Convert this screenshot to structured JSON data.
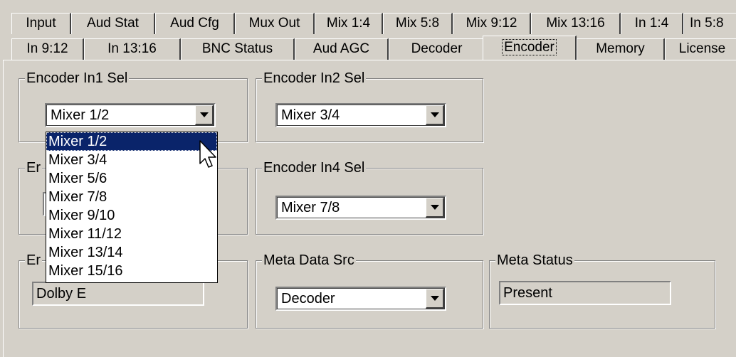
{
  "tabs": {
    "row1": [
      {
        "label": "Input"
      },
      {
        "label": "Aud Stat"
      },
      {
        "label": "Aud Cfg"
      },
      {
        "label": "Mux Out"
      },
      {
        "label": "Mix 1:4"
      },
      {
        "label": "Mix 5:8"
      },
      {
        "label": "Mix 9:12"
      },
      {
        "label": "Mix 13:16"
      },
      {
        "label": "In 1:4"
      },
      {
        "label": "In 5:8"
      }
    ],
    "row2": [
      {
        "label": "In 9:12"
      },
      {
        "label": "In 13:16"
      },
      {
        "label": "BNC Status"
      },
      {
        "label": "Aud AGC"
      },
      {
        "label": "Decoder"
      },
      {
        "label": "Encoder"
      },
      {
        "label": "Memory"
      },
      {
        "label": "License"
      }
    ],
    "active": "Encoder"
  },
  "groups": {
    "in1": {
      "title": "Encoder In1 Sel",
      "value": "Mixer 1/2"
    },
    "in2": {
      "title": "Encoder In2 Sel",
      "value": "Mixer 3/4"
    },
    "in3": {
      "title": "Er"
    },
    "in4": {
      "title": "Encoder In4 Sel",
      "value": "Mixer 7/8"
    },
    "fmt": {
      "title": "Er",
      "value": "Dolby E"
    },
    "meta_src": {
      "title": "Meta Data Src",
      "value": "Decoder"
    },
    "meta_status": {
      "title": "Meta Status",
      "value": "Present"
    }
  },
  "dropdown": {
    "options": [
      "Mixer 1/2",
      "Mixer 3/4",
      "Mixer 5/6",
      "Mixer 7/8",
      "Mixer 9/10",
      "Mixer 11/12",
      "Mixer 13/14",
      "Mixer 15/16"
    ],
    "selected": "Mixer 1/2"
  },
  "icons": {
    "cursor": "arrow-cursor-icon",
    "dropdown_arrow": "chevron-down-icon"
  },
  "colors": {
    "face": "#d4d0c8",
    "highlight": "#0a246a"
  }
}
